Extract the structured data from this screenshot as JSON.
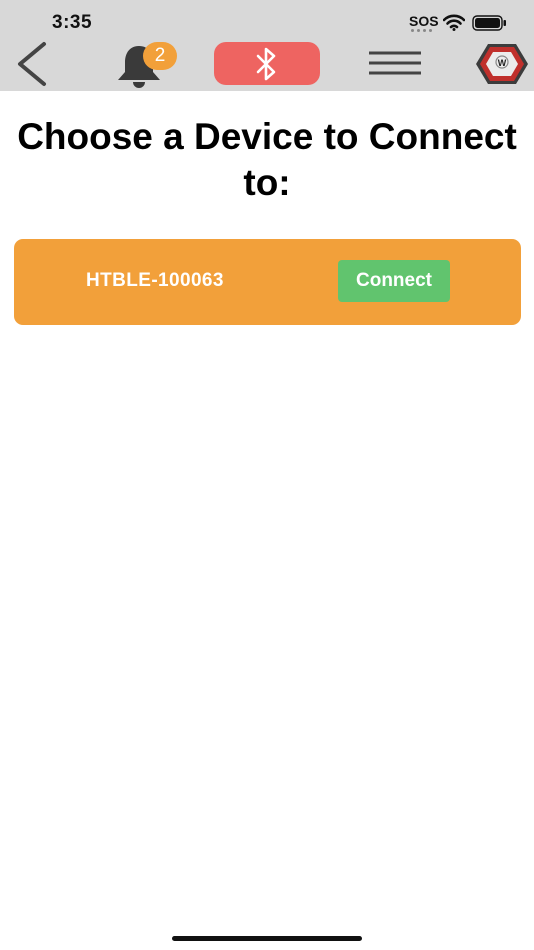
{
  "status_bar": {
    "time": "3:35",
    "sos": "SOS"
  },
  "nav": {
    "back_icon": "chevron-left-icon",
    "notifications_icon": "bell-icon",
    "notification_count": "2",
    "bluetooth_icon": "bluetooth-icon",
    "menu_icon": "hamburger-menu-icon",
    "logo_letter": "W",
    "colors": {
      "bar": "#d8d8d8",
      "badge": "#f2a03a",
      "bluetooth_button": "#ee6461"
    }
  },
  "main": {
    "title": "Choose a Device to Connect to:",
    "devices": [
      {
        "name": "HTBLE-100063",
        "action_label": "Connect"
      }
    ],
    "colors": {
      "card": "#f2a03a",
      "connect_button": "#61c46e"
    }
  }
}
